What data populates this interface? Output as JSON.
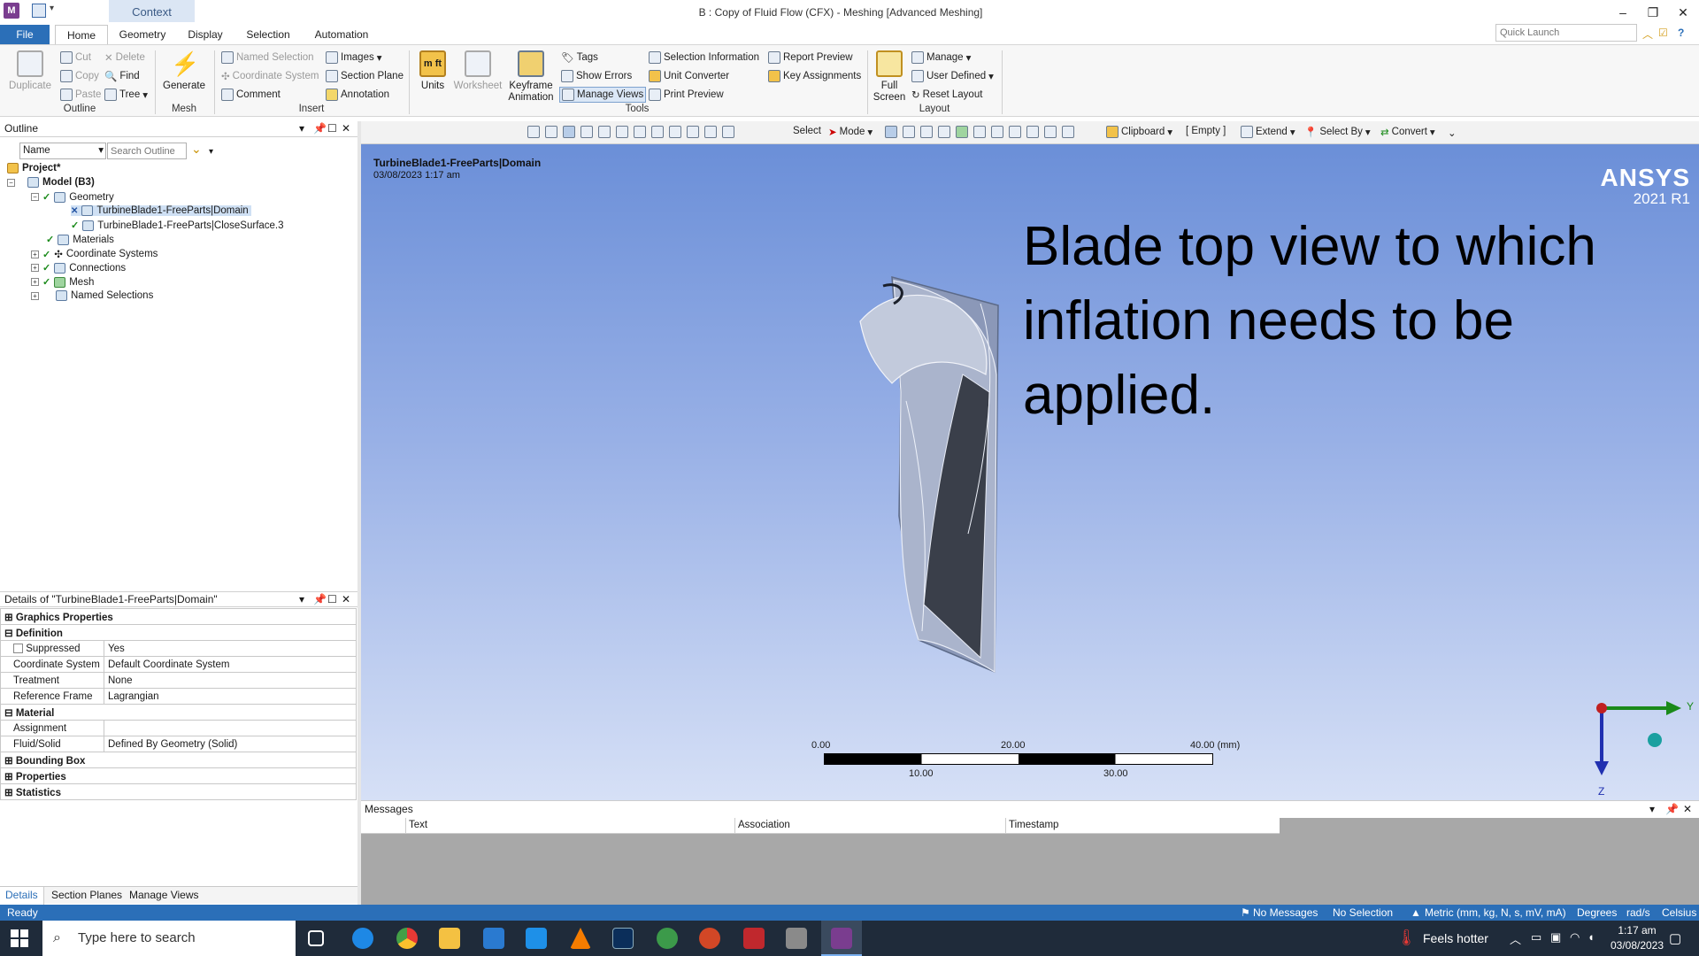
{
  "titlebar": {
    "context_tab": "Context",
    "title": "B : Copy of Fluid Flow (CFX) - Meshing [Advanced Meshing]",
    "minimize": "–",
    "restore": "❐",
    "close": "✕"
  },
  "tabs": [
    {
      "label": "File"
    },
    {
      "label": "Home"
    },
    {
      "label": "Geometry"
    },
    {
      "label": "Display"
    },
    {
      "label": "Selection"
    },
    {
      "label": "Automation"
    }
  ],
  "quick_launch": {
    "placeholder": "Quick Launch"
  },
  "ribbon": {
    "duplicate": "Duplicate",
    "cut": "Cut",
    "copy": "Copy",
    "paste": "Paste",
    "delete": "Delete",
    "find": "Find",
    "tree": "Tree",
    "group_outline": "Outline",
    "generate": "Generate",
    "group_mesh": "Mesh",
    "named_selection": "Named Selection",
    "coordinate_system": "Coordinate System",
    "comment": "Comment",
    "images": "Images",
    "section_plane": "Section Plane",
    "annotation": "Annotation",
    "group_insert": "Insert",
    "units": "Units",
    "worksheet": "Worksheet",
    "keyframe_1": "Keyframe",
    "keyframe_2": "Animation",
    "tags": "Tags",
    "show_errors": "Show Errors",
    "manage_views": "Manage Views",
    "selection_information": "Selection Information",
    "unit_converter": "Unit Converter",
    "print_preview": "Print Preview",
    "report_preview": "Report Preview",
    "key_assignments": "Key Assignments",
    "group_tools": "Tools",
    "full_1": "Full",
    "full_2": "Screen",
    "manage": "Manage",
    "user_defined": "User Defined",
    "reset_layout": "Reset Layout",
    "group_layout": "Layout"
  },
  "toolbar2": {
    "select": "Select",
    "mode": "Mode",
    "clipboard": "Clipboard",
    "empty": "[ Empty ]",
    "extend": "Extend",
    "select_by": "Select By",
    "convert": "Convert"
  },
  "outline": {
    "title": "Outline",
    "name_filter": "Name",
    "search_placeholder": "Search Outline",
    "tree": [
      {
        "label": "Project*"
      },
      {
        "label": "Model (B3)"
      },
      {
        "label": "Geometry"
      },
      {
        "label": "TurbineBlade1-FreeParts|Domain"
      },
      {
        "label": "TurbineBlade1-FreeParts|CloseSurface.3"
      },
      {
        "label": "Materials"
      },
      {
        "label": "Coordinate Systems"
      },
      {
        "label": "Connections"
      },
      {
        "label": "Mesh"
      },
      {
        "label": "Named Selections"
      }
    ]
  },
  "details": {
    "title": "Details of \"TurbineBlade1-FreeParts|Domain\"",
    "rows": [
      {
        "k": "Graphics Properties",
        "v": ""
      },
      {
        "k": "Definition",
        "v": ""
      },
      {
        "k": "Suppressed",
        "v": "Yes"
      },
      {
        "k": "Coordinate System",
        "v": "Default Coordinate System"
      },
      {
        "k": "Treatment",
        "v": "None"
      },
      {
        "k": "Reference Frame",
        "v": "Lagrangian"
      },
      {
        "k": "Material",
        "v": ""
      },
      {
        "k": "Assignment",
        "v": ""
      },
      {
        "k": "Fluid/Solid",
        "v": "Defined By Geometry (Solid)"
      },
      {
        "k": "Bounding Box",
        "v": ""
      },
      {
        "k": "Properties",
        "v": ""
      },
      {
        "k": "Statistics",
        "v": ""
      }
    ],
    "tabs": [
      {
        "label": "Details"
      },
      {
        "label": "Section Planes"
      },
      {
        "label": "Manage Views"
      }
    ]
  },
  "viewport": {
    "model_name": "TurbineBlade1-FreeParts|Domain",
    "timestamp": "03/08/2023 1:17 am",
    "brand": "ANSYS",
    "version": "2021 R1",
    "annotation_lines": [
      "Blade top view to which",
      "inflation needs to be",
      "applied."
    ],
    "scale": {
      "t0": "0.00",
      "t20": "20.00",
      "t40": "40.00 (mm)",
      "t10": "10.00",
      "t30": "30.00"
    },
    "axis_y": "Y",
    "axis_z": "Z"
  },
  "messages": {
    "title": "Messages",
    "columns": [
      "Text",
      "Association",
      "Timestamp"
    ]
  },
  "status": {
    "ready": "Ready",
    "no_messages": "No Messages",
    "no_selection": "No Selection",
    "units": "Metric (mm, kg, N, s, mV, mA)",
    "degrees": "Degrees",
    "rads": "rad/s",
    "celsius": "Celsius"
  },
  "taskbar": {
    "search_placeholder": "Type here to search",
    "weather": "Feels hotter",
    "time": "1:17 am",
    "date": "03/08/2023"
  }
}
